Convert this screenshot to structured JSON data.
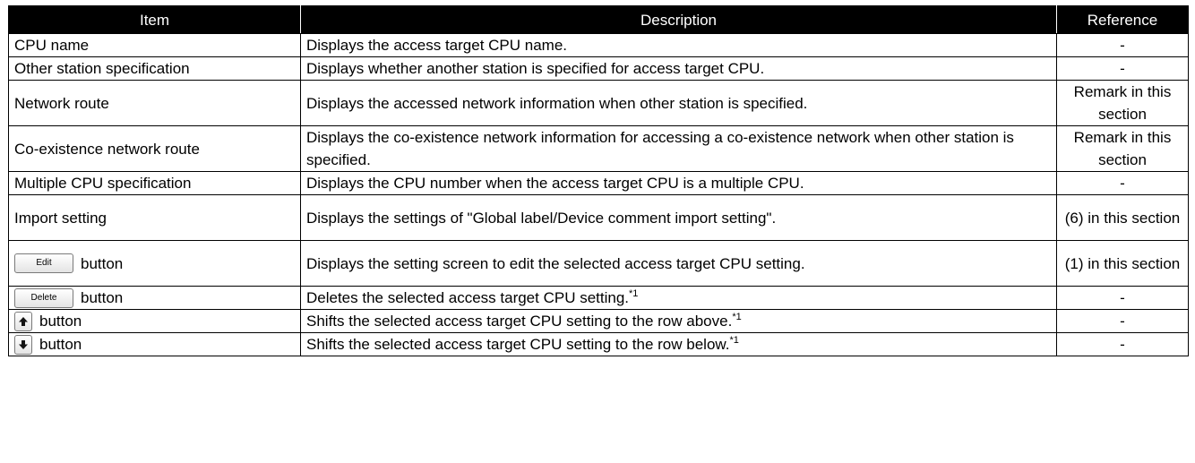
{
  "table": {
    "headers": [
      "Item",
      "Description",
      "Reference"
    ],
    "rows": [
      {
        "item": "CPU name",
        "description": "Displays the access target CPU name.",
        "reference": "-"
      },
      {
        "item": "Other station specification",
        "description": "Displays whether another station is specified for access target CPU.",
        "reference": "-"
      },
      {
        "item": "Network route",
        "description": "Displays the accessed network information when other station is specified.",
        "reference": "Remark in this section"
      },
      {
        "item": "Co-existence network route",
        "description": "Displays the co-existence network information for accessing a co-existence network when other station is specified.",
        "reference": "Remark in this section"
      },
      {
        "item": "Multiple CPU specification",
        "description": "Displays the CPU number when the access target CPU is a multiple CPU.",
        "reference": "-"
      },
      {
        "item": "Import setting",
        "description": "Displays the settings of \"Global label/Device comment import setting\".",
        "reference": "(6) in this section"
      },
      {
        "item_button": "Edit",
        "item_suffix": "button",
        "description": "Displays the setting screen to edit the selected access target CPU setting.",
        "reference": "(1) in this section"
      },
      {
        "item_button": "Delete",
        "item_suffix": "button",
        "description": "Deletes the selected access target CPU setting.",
        "footnote": "*1",
        "reference": "-"
      },
      {
        "item_icon": "arrow-up-icon",
        "item_suffix": "button",
        "description": "Shifts the selected access target CPU setting to the row above.",
        "footnote": "*1",
        "reference": "-"
      },
      {
        "item_icon": "arrow-down-icon",
        "item_suffix": "button",
        "description": "Shifts the selected access target CPU setting to the row below.",
        "footnote": "*1",
        "reference": "-"
      }
    ]
  }
}
